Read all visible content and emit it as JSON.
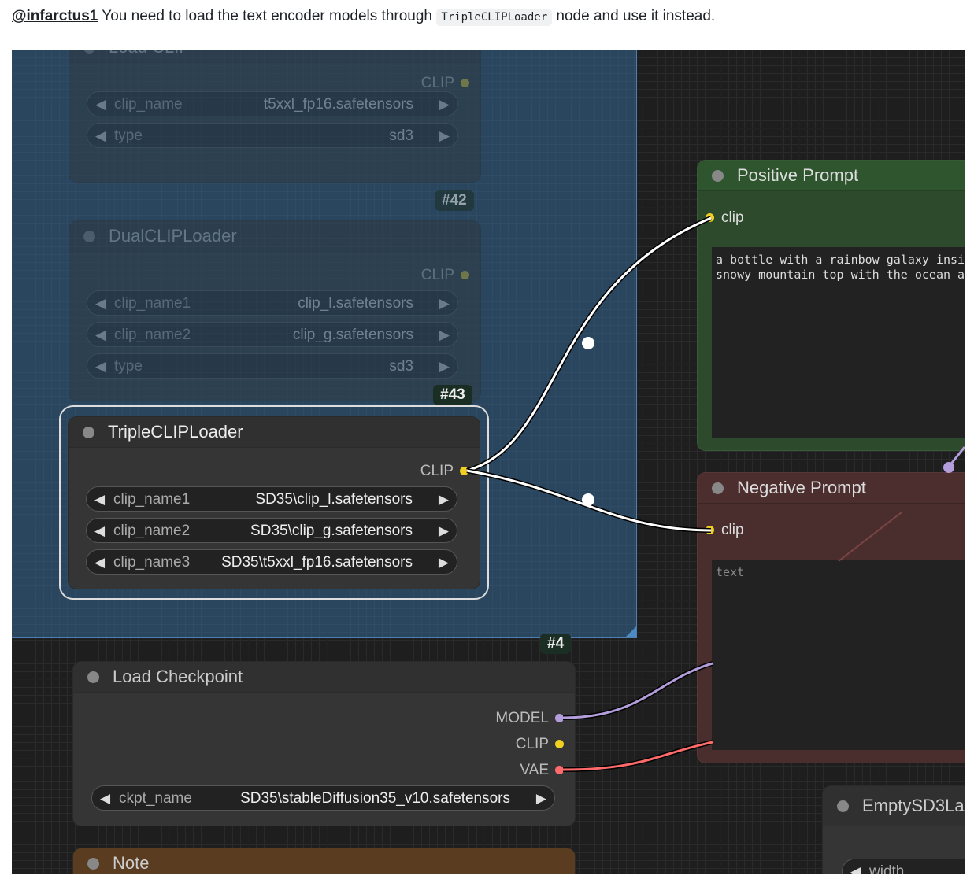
{
  "comment": {
    "mention": "@infarctus1",
    "text_before": " You need to load the text encoder models through ",
    "code": "TripleCLIPLoader",
    "text_after": " node and use it instead."
  },
  "nodes": {
    "load_clip": {
      "title": "Load CLIP",
      "output": "CLIP",
      "widgets": [
        {
          "name": "clip_name",
          "value": "t5xxl_fp16.safetensors"
        },
        {
          "name": "type",
          "value": "sd3"
        }
      ]
    },
    "dual_clip": {
      "badge": "#42",
      "title": "DualCLIPLoader",
      "output": "CLIP",
      "widgets": [
        {
          "name": "clip_name1",
          "value": "clip_l.safetensors"
        },
        {
          "name": "clip_name2",
          "value": "clip_g.safetensors"
        },
        {
          "name": "type",
          "value": "sd3"
        }
      ]
    },
    "triple_clip": {
      "badge": "#43",
      "title": "TripleCLIPLoader",
      "output": "CLIP",
      "widgets": [
        {
          "name": "clip_name1",
          "value": "SD35\\clip_l.safetensors"
        },
        {
          "name": "clip_name2",
          "value": "SD35\\clip_g.safetensors"
        },
        {
          "name": "clip_name3",
          "value": "SD35\\t5xxl_fp16.safetensors"
        }
      ]
    },
    "positive": {
      "title": "Positive Prompt",
      "input": "clip",
      "text": "a bottle with a rainbow galaxy insi\nsnowy mountain top with the ocean a"
    },
    "negative": {
      "title": "Negative Prompt",
      "input": "clip",
      "placeholder": "text"
    },
    "checkpoint": {
      "badge": "#4",
      "title": "Load Checkpoint",
      "outputs": [
        "MODEL",
        "CLIP",
        "VAE"
      ],
      "widget": {
        "name": "ckpt_name",
        "value": "SD35\\stableDiffusion35_v10.safetensors"
      }
    },
    "empty_latent": {
      "title": "EmptySD3La",
      "widget_name": "width"
    },
    "note": {
      "title": "Note"
    }
  },
  "colors": {
    "clip_port": "#f0d020",
    "model_port": "#b39ddb",
    "vae_port": "#ff6b6b",
    "positive_bg": "#2d4a2d",
    "negative_bg": "#4a2d2d"
  }
}
